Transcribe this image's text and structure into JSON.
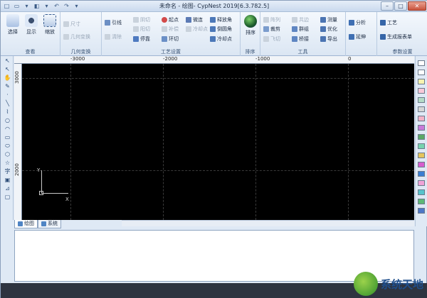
{
  "window": {
    "title": "未命名 - 绘图- CypNest 2019[6.3.782.5]"
  },
  "quick_access": [
    "□",
    "▭",
    "▾",
    "◧",
    "▾",
    "↶",
    "↷",
    "▾"
  ],
  "window_controls": {
    "minimize": "–",
    "maximize": "□",
    "close": "✕"
  },
  "ribbon": {
    "groups": {
      "view": {
        "label": "查看",
        "buttons": [
          "选择",
          "显示",
          "缩放"
        ]
      },
      "geometry": {
        "label": "几何变换",
        "buttons": [
          "尺寸",
          "几何变换"
        ]
      },
      "process": {
        "label": "工艺设置",
        "buttons": [
          "引线",
          "清除",
          "阴切",
          "阳切",
          "停靠",
          "起点",
          "补偿",
          "环切",
          "微连",
          "冷却点",
          "释放角",
          "倒圆角",
          "冷却点"
        ]
      },
      "sort": {
        "label": "排序",
        "buttons": [
          "排序"
        ]
      },
      "tools": {
        "label": "工具",
        "buttons": [
          "阵列",
          "裁剪",
          "飞切",
          "共边",
          "群组",
          "桥接",
          "测量",
          "优化",
          "导出"
        ]
      },
      "analysis": {
        "label": "",
        "buttons": [
          "分析",
          "延伸"
        ]
      },
      "params": {
        "label": "参数设置",
        "buttons": [
          "工艺",
          "生成报表单"
        ]
      }
    }
  },
  "ruler": {
    "h_labels": [
      "-3000",
      "-2000",
      "-1000",
      "0"
    ],
    "v_labels": [
      "3000",
      "2000"
    ]
  },
  "canvas": {
    "axis_x": "X",
    "axis_y": "Y"
  },
  "tabs": [
    {
      "label": "绘图"
    },
    {
      "label": "系统"
    }
  ],
  "palette_colors": [
    "#ffffff",
    "#ffffff",
    "#f7f3b0",
    "#f7c9d8",
    "#b4dbc6",
    "#d6d6d6",
    "#f3b2c7",
    "#c97ad9",
    "#5aa866",
    "#76d3ae",
    "#e4c45c",
    "#d65dce",
    "#3a7ed2",
    "#f0a3d6",
    "#57c3cc",
    "#5fb876",
    "#4e77c7"
  ],
  "watermark": {
    "text": "系统天地"
  }
}
